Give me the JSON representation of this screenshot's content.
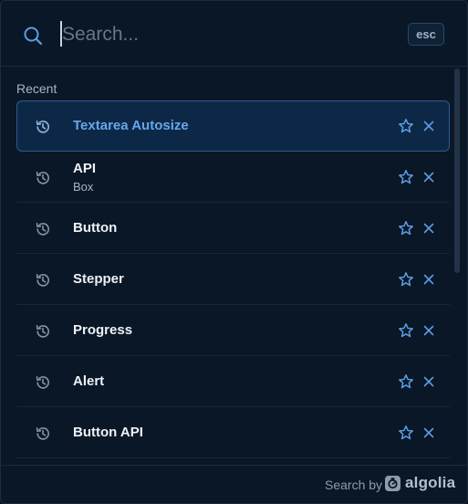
{
  "search": {
    "placeholder": "Search...",
    "value": "",
    "esc_label": "esc"
  },
  "results": {
    "section_label": "Recent",
    "items": [
      {
        "title": "Textarea Autosize",
        "subtitle": "",
        "active": true
      },
      {
        "title": "API",
        "subtitle": "Box",
        "active": false
      },
      {
        "title": "Button",
        "subtitle": "",
        "active": false
      },
      {
        "title": "Stepper",
        "subtitle": "",
        "active": false
      },
      {
        "title": "Progress",
        "subtitle": "",
        "active": false
      },
      {
        "title": "Alert",
        "subtitle": "",
        "active": false
      },
      {
        "title": "Button API",
        "subtitle": "",
        "active": false
      }
    ]
  },
  "footer": {
    "label": "Search by",
    "brand": "algolia"
  },
  "colors": {
    "accent": "#66a6ec",
    "background": "#0a1726",
    "active_item_bg": "#0d2846"
  },
  "icons": {
    "search": "search-icon",
    "history": "history-icon",
    "favorite": "star-icon",
    "remove": "close-icon",
    "brand": "algolia-logo"
  }
}
